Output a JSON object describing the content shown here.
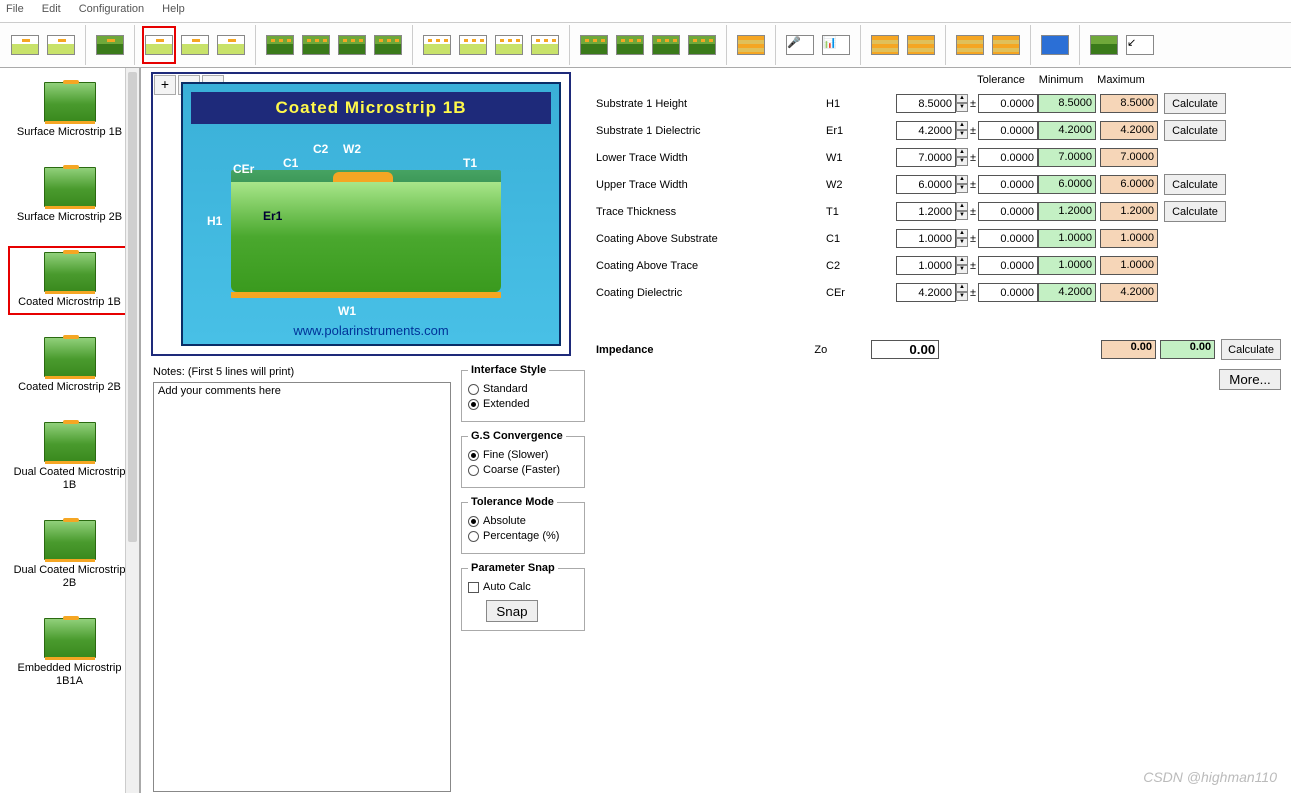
{
  "menu": [
    "File",
    "Edit",
    "Configuration",
    "Help"
  ],
  "sidebar": {
    "items": [
      {
        "label": "Surface Microstrip 1B"
      },
      {
        "label": "Surface Microstrip 2B"
      },
      {
        "label": "Coated Microstrip 1B",
        "selected": true
      },
      {
        "label": "Coated Microstrip 2B"
      },
      {
        "label": "Dual Coated Microstrip 1B"
      },
      {
        "label": "Dual Coated Microstrip 2B"
      },
      {
        "label": "Embedded Microstrip 1B1A"
      }
    ]
  },
  "preview": {
    "title": "Coated Microstrip 1B",
    "labels": {
      "H1": "H1",
      "Er1": "Er1",
      "W1": "W1",
      "W2": "W2",
      "T1": "T1",
      "C1": "C1",
      "C2": "C2",
      "CEr": "CEr"
    },
    "url": "www.polarinstruments.com",
    "zoom_in": "+",
    "zoom_out": "−",
    "magnifier": "⌕"
  },
  "params": {
    "headers": {
      "tolerance": "Tolerance",
      "minimum": "Minimum",
      "maximum": "Maximum"
    },
    "rows": [
      {
        "name": "Substrate 1 Height",
        "sym": "H1",
        "val": "8.5000",
        "tol": "0.0000",
        "min": "8.5000",
        "max": "8.5000",
        "calc": true
      },
      {
        "name": "Substrate 1 Dielectric",
        "sym": "Er1",
        "val": "4.2000",
        "tol": "0.0000",
        "min": "4.2000",
        "max": "4.2000",
        "calc": true
      },
      {
        "name": "Lower Trace Width",
        "sym": "W1",
        "val": "7.0000",
        "tol": "0.0000",
        "min": "7.0000",
        "max": "7.0000",
        "calc": false
      },
      {
        "name": "Upper Trace Width",
        "sym": "W2",
        "val": "6.0000",
        "tol": "0.0000",
        "min": "6.0000",
        "max": "6.0000",
        "calc": true
      },
      {
        "name": "Trace Thickness",
        "sym": "T1",
        "val": "1.2000",
        "tol": "0.0000",
        "min": "1.2000",
        "max": "1.2000",
        "calc": true
      },
      {
        "name": "Coating Above Substrate",
        "sym": "C1",
        "val": "1.0000",
        "tol": "0.0000",
        "min": "1.0000",
        "max": "1.0000",
        "calc": false
      },
      {
        "name": "Coating Above Trace",
        "sym": "C2",
        "val": "1.0000",
        "tol": "0.0000",
        "min": "1.0000",
        "max": "1.0000",
        "calc": false
      },
      {
        "name": "Coating Dielectric",
        "sym": "CEr",
        "val": "4.2000",
        "tol": "0.0000",
        "min": "4.2000",
        "max": "4.2000",
        "calc": false
      }
    ],
    "pm": "±",
    "calc_label": "Calculate",
    "impedance": {
      "label": "Impedance",
      "sym": "Zo",
      "val": "0.00",
      "min": "0.00",
      "max": "0.00"
    },
    "more": "More..."
  },
  "notes": {
    "label": "Notes: (First 5 lines will print)",
    "placeholder": "Add your comments here"
  },
  "fieldsets": {
    "interface": {
      "legend": "Interface Style",
      "opts": [
        "Standard",
        "Extended"
      ],
      "sel": 1
    },
    "gs": {
      "legend": "G.S Convergence",
      "opts": [
        "Fine (Slower)",
        "Coarse (Faster)"
      ],
      "sel": 0
    },
    "tol": {
      "legend": "Tolerance Mode",
      "opts": [
        "Absolute",
        "Percentage (%)"
      ],
      "sel": 0
    },
    "snap": {
      "legend": "Parameter Snap",
      "check": "Auto Calc",
      "button": "Snap"
    }
  },
  "watermark": "CSDN @highman110"
}
